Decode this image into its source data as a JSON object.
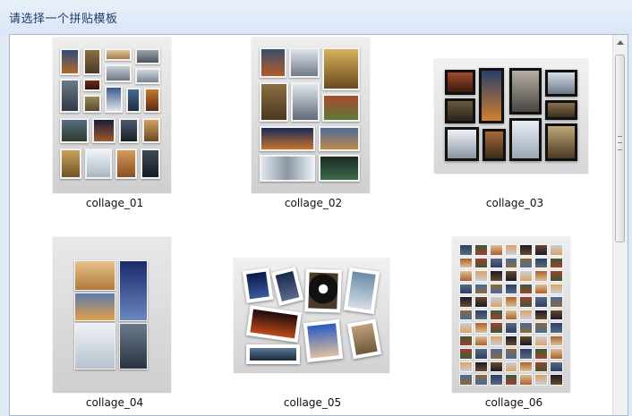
{
  "dialog": {
    "title": "请选择一个拼贴模板"
  },
  "templates": [
    {
      "name": "collage_01"
    },
    {
      "name": "collage_02"
    },
    {
      "name": "collage_03"
    },
    {
      "name": "collage_04"
    },
    {
      "name": "collage_05"
    },
    {
      "name": "collage_06"
    }
  ]
}
